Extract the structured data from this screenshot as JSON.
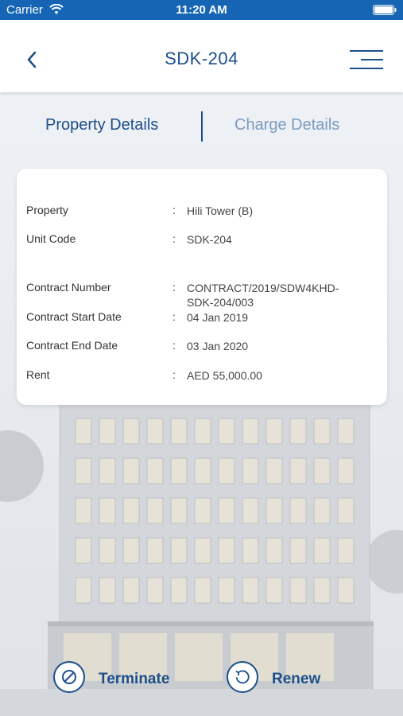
{
  "status_bar": {
    "carrier": "Carrier",
    "time": "11:20 AM"
  },
  "header": {
    "title": "SDK-204"
  },
  "tabs": [
    {
      "label": "Property Details",
      "active": true
    },
    {
      "label": "Charge Details",
      "active": false
    }
  ],
  "details": [
    {
      "label": "Property",
      "value": "Hili Tower (B)"
    },
    {
      "label": "Unit Code",
      "value": "SDK-204"
    },
    {
      "label": "Contract Number",
      "value": "CONTRACT/2019/SDW4KHD-SDK-204/003"
    },
    {
      "label": "Contract Start Date",
      "value": "04 Jan 2019"
    },
    {
      "label": "Contract End Date",
      "value": "03 Jan 2020"
    },
    {
      "label": "Rent",
      "value": "AED 55,000.00"
    }
  ],
  "separator": ":",
  "actions": {
    "terminate_label": "Terminate",
    "renew_label": "Renew"
  },
  "colors": {
    "primary": "#1c4f8a",
    "status_bar": "#1565b4",
    "inactive_tab": "#7b9bc1"
  }
}
